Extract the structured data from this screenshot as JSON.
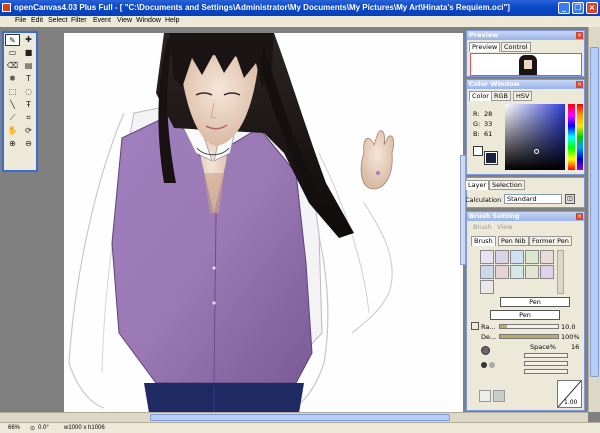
{
  "window": {
    "title": "openCanvas4.03 Plus Full  - [ \"C:\\Documents and Settings\\Administrator\\My Documents\\My Pictures\\My Art\\Hinata's Requiem.oci\"]",
    "min_glyph": "_",
    "max_glyph": "❐",
    "close_glyph": "×"
  },
  "menu": [
    "File",
    "Edit",
    "Select",
    "Filter",
    "Event",
    "View",
    "Window",
    "Help"
  ],
  "status": {
    "zoom": "66%",
    "rotation": "0.0°",
    "size": "w1000 x h1006"
  },
  "preview": {
    "title": "Preview",
    "tabs": [
      "Preview",
      "Control"
    ]
  },
  "color_window": {
    "title": "Color Window",
    "tabs": [
      "Color",
      "RGB",
      "HSV"
    ],
    "r_label": "R:",
    "r": "28",
    "g_label": "G:",
    "g": "33",
    "b_label": "B:",
    "b": "61",
    "current_color": "#1c213d"
  },
  "layer": {
    "tabs": [
      "Layer",
      "Selection"
    ],
    "calc_label": "Calculation",
    "calc_value": "Standard"
  },
  "brush": {
    "title": "Brush Setting",
    "subtabs": [
      "Brush",
      "View"
    ],
    "tabs": [
      "Brush",
      "Pen Nib",
      "Former Pen"
    ],
    "name_primary": "Pen",
    "name_secondary": "Pen",
    "radius_label": "Ra...",
    "radius": "10.0",
    "radius_level": 0.12,
    "density_label": "De...",
    "density": "100%",
    "density_level": 1.0,
    "spacing_label": "Space%",
    "spacing": "16",
    "curve_value": "1.00"
  },
  "colors": {
    "title_blue": "#0b47c7",
    "panel_border": "#7a96df",
    "accent_violet": "#a47fbd"
  }
}
